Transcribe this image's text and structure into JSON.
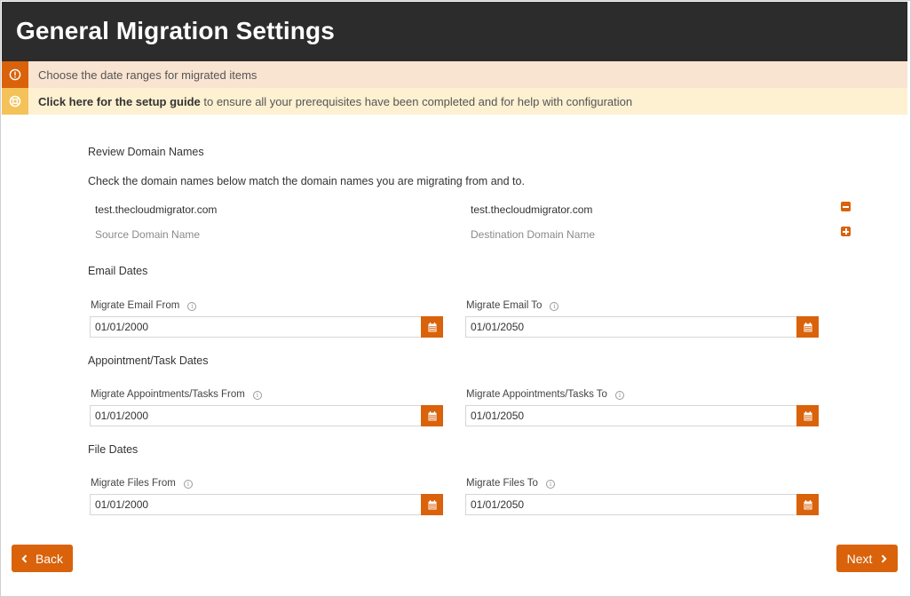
{
  "page": {
    "title": "General Migration Settings"
  },
  "banners": {
    "info_text": "Choose the date ranges for migrated items",
    "guide_link": "Click here for the setup guide",
    "guide_text": " to ensure all your prerequisites have been completed and for help with configuration"
  },
  "domains": {
    "heading": "Review Domain Names",
    "description": "Check the domain names below match the domain names you are migrating from and to.",
    "rows": [
      {
        "source": "test.thecloudmigrator.com",
        "destination": "test.thecloudmigrator.com"
      }
    ],
    "source_placeholder": "Source Domain Name",
    "destination_placeholder": "Destination Domain Name"
  },
  "email": {
    "heading": "Email Dates",
    "from_label": "Migrate Email From",
    "from_value": "01/01/2000",
    "to_label": "Migrate Email To",
    "to_value": "01/01/2050"
  },
  "appointments": {
    "heading": "Appointment/Task Dates",
    "from_label": "Migrate Appointments/Tasks From",
    "from_value": "01/01/2000",
    "to_label": "Migrate Appointments/Tasks To",
    "to_value": "01/01/2050"
  },
  "files": {
    "heading": "File Dates",
    "from_label": "Migrate Files From",
    "from_value": "01/01/2000",
    "to_label": "Migrate Files To",
    "to_value": "01/01/2050"
  },
  "nav": {
    "back_label": "Back",
    "next_label": "Next"
  },
  "colors": {
    "accent": "#d9620a",
    "header_bg": "#2c2c2c",
    "info_bg": "#f9e4d2",
    "guide_bg": "#fdf1d2",
    "guide_icon": "#f5c259"
  },
  "icons": {
    "info": "info-circle-icon",
    "guide": "life-ring-icon",
    "remove": "minus-square-icon",
    "add": "plus-square-icon",
    "calendar": "calendar-icon",
    "back": "chevron-left-icon",
    "next": "chevron-right-icon"
  }
}
